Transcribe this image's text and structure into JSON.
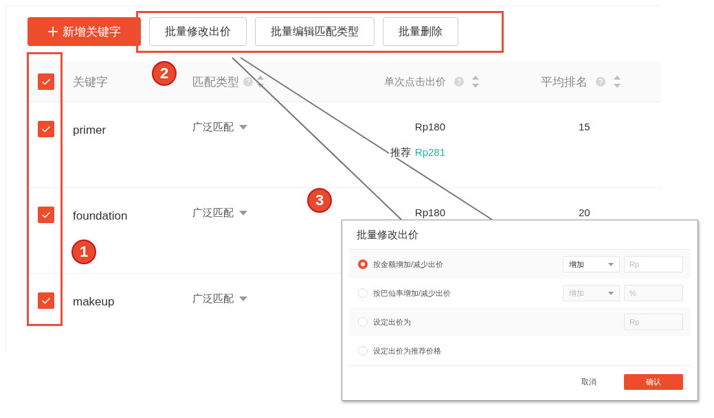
{
  "toolbar": {
    "add_button": "新增关键字",
    "batch_buttons": [
      "批量修改出价",
      "批量编辑匹配类型",
      "批量删除"
    ]
  },
  "table": {
    "select_all_checked": true,
    "columns": [
      {
        "label": "关键字",
        "help": false,
        "sortable": false
      },
      {
        "label": "匹配类型",
        "help": true,
        "sortable": true
      },
      {
        "label": "单次点击出价",
        "help": true,
        "sortable": true
      },
      {
        "label": "平均排名",
        "help": true,
        "sortable": true
      }
    ],
    "rows": [
      {
        "checked": true,
        "keyword": "primer",
        "match_type": "广泛匹配",
        "bid": "Rp180",
        "suggest_label": "推荐",
        "suggest_value": "Rp281",
        "rank": "15"
      },
      {
        "checked": true,
        "keyword": "foundation",
        "match_type": "广泛匹配",
        "bid": "Rp180",
        "rank": "20"
      },
      {
        "checked": true,
        "keyword": "makeup",
        "match_type": "广泛匹配"
      }
    ]
  },
  "dialog": {
    "title": "批量修改出价",
    "options": [
      {
        "label": "按金额增加/减少出价",
        "selected": true,
        "dropdown": "增加",
        "placeholder": "Rp"
      },
      {
        "label": "按巴仙率增加/减少出价",
        "selected": false,
        "dropdown": "增加",
        "placeholder": "%"
      },
      {
        "label": "设定出价为",
        "selected": false,
        "placeholder": "Rp"
      },
      {
        "label": "设定出价为推荐价格",
        "selected": false
      }
    ],
    "cancel": "取消",
    "confirm": "确认"
  },
  "callouts": [
    "1",
    "2",
    "3"
  ]
}
